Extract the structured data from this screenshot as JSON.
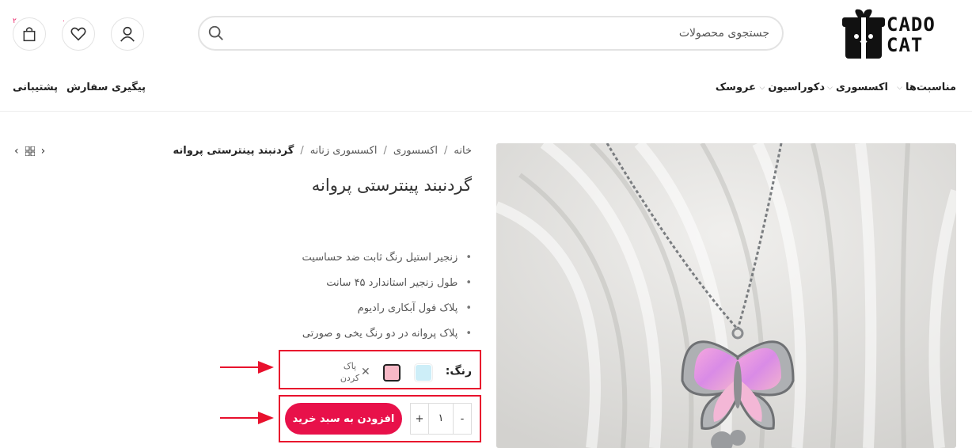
{
  "header": {
    "logo_text": "CADO CAT",
    "search_placeholder": "جستجوی محصولات",
    "cart_count": "۲",
    "wishlist_count": "۰"
  },
  "nav": {
    "occasions": "مناسبت‌ها",
    "accessories": "اکسسوری",
    "decoration": "دکوراسیون",
    "doll": "عروسک",
    "order_tracking": "پیگیری سفارش",
    "support": "پشتیبانی"
  },
  "breadcrumb": {
    "home": "خانه",
    "accessories": "اکسسوری",
    "women_accessories": "اکسسوری زنانه",
    "current": "گردنبند پینترستی پروانه",
    "separator": "/"
  },
  "product": {
    "title": "گردنبند پینترستی پروانه",
    "features": [
      "زنجیر استیل رنگ ثابت ضد حساسیت",
      "طول زنجیر استاندارد ۴۵ سانت",
      "پلاک فول آبکاری رادیوم",
      "پلاک پروانه در دو رنگ یخی و صورتی"
    ],
    "color_label": "رنگ:",
    "clear_line1": "پاک",
    "clear_line2": "کردن",
    "swatch_colors": [
      "#f7b8c6",
      "#cdeef8"
    ],
    "quantity": "۱",
    "minus": "-",
    "plus": "+",
    "add_to_cart": "افزودن به سبد خرید"
  },
  "colors": {
    "accent": "#e8114a",
    "annotation_red": "#e8112d"
  }
}
